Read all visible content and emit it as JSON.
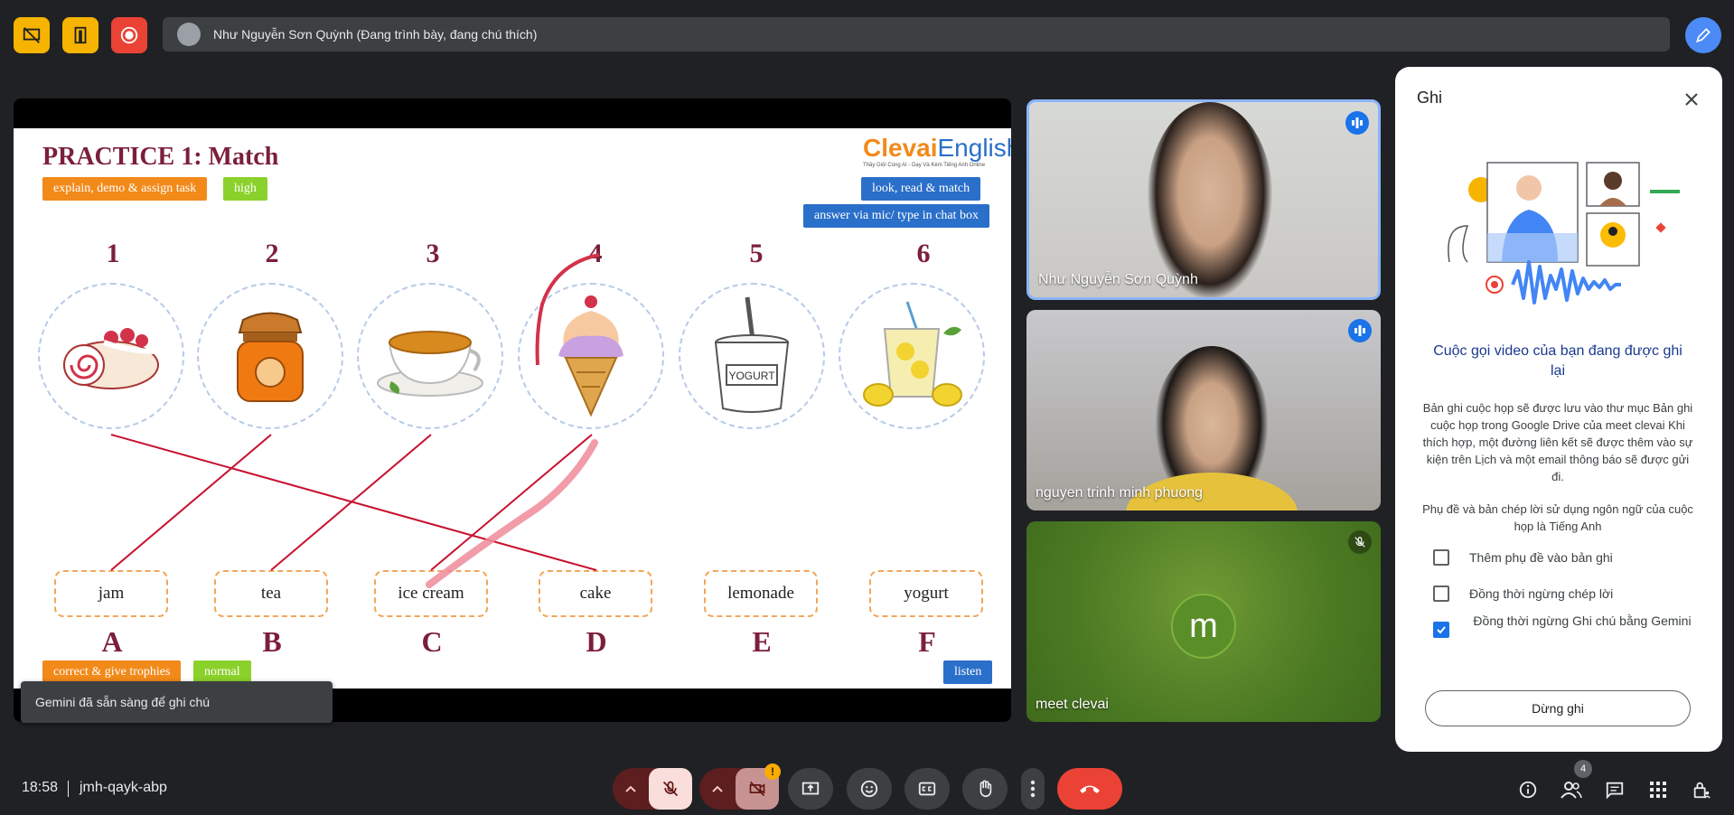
{
  "header": {
    "presenter_text": "Như Nguyễn Sơn Quỳnh (Đang trình bày, đang chú thích)"
  },
  "slide": {
    "title": "PRACTICE 1: Match",
    "tag_task": "explain, demo & assign task",
    "tag_level": "high",
    "tag_activity": "look, read & match",
    "tag_answer": "answer via mic/ type in chat box",
    "logo_brand": "Clevai",
    "logo_brand2": "English",
    "logo_tagline": "Thầy Giỏi Cùng AI - Dạy Và Kèm Tiếng Anh Online",
    "numbers": [
      "1",
      "2",
      "3",
      "4",
      "5",
      "6"
    ],
    "pictures": [
      "cake-roll-icon",
      "jam-jar-icon",
      "tea-cup-icon",
      "ice-cream-icon",
      "yogurt-icon",
      "lemonade-icon"
    ],
    "yogurt_label": "YOGURT",
    "words": [
      "jam",
      "tea",
      "ice cream",
      "cake",
      "lemonade",
      "yogurt"
    ],
    "letters": [
      "A",
      "B",
      "C",
      "D",
      "E",
      "F"
    ],
    "tag_correct": "correct & give trophies",
    "tag_normal": "normal",
    "tag_listen": "listen"
  },
  "toast": "Gemini đã sẵn sàng để ghi chú",
  "tiles": [
    {
      "name": "Như Nguyễn Sơn Quỳnh",
      "state": "speaking"
    },
    {
      "name": "nguyen trinh minh phuong",
      "state": "speaking"
    },
    {
      "name": "meet clevai",
      "avatar_letter": "m",
      "state": "muted"
    }
  ],
  "panel": {
    "title": "Ghi",
    "heading": "Cuộc gọi video của bạn đang được ghi lại",
    "para1": "Bản ghi cuộc họp sẽ được lưu vào thư mục Bản ghi cuộc họp trong Google Drive của meet clevai Khi thích hợp, một đường liên kết sẽ được thêm vào sự kiện trên Lịch và một email thông báo sẽ được gửi đi.",
    "para2": "Phụ đề và bản chép lời sử dụng ngôn ngữ của cuộc họp là Tiếng Anh",
    "options": [
      {
        "label": "Thêm phụ đề vào bản ghi",
        "checked": false
      },
      {
        "label": "Đồng thời ngừng chép lời",
        "checked": false
      },
      {
        "label": "Đồng thời ngừng Ghi chú bằng Gemini",
        "checked": true
      }
    ],
    "stop_label": "Dừng ghi"
  },
  "footer": {
    "time": "18:58",
    "meeting_code": "jmh-qayk-abp",
    "people_count": "4",
    "camera_warning": "!"
  },
  "colors": {
    "accent": "#1a73e8",
    "hangup": "#ea4335",
    "annotation": "#c8102e"
  }
}
